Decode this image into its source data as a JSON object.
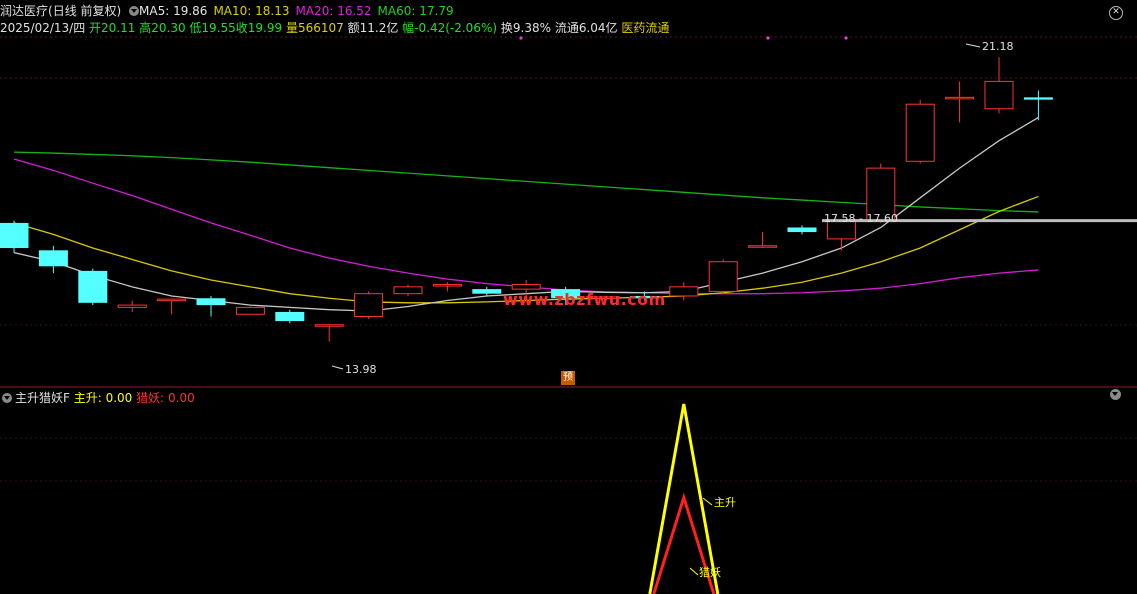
{
  "header": {
    "stock_name": "润达医疗",
    "period_label": "(日线 前复权)",
    "ma5_label": "MA5: 19.86",
    "ma10_label": "MA10: 18.13",
    "ma20_label": "MA20: 16.52",
    "ma60_label": "MA60: 17.79",
    "date": "2025/02/13/四",
    "open": "开20.11",
    "high": "高20.30",
    "low": "低19.55",
    "close": "收19.99",
    "volume": "量566107",
    "amount": "额11.2亿",
    "change": "幅-0.42(-2.06%)",
    "turnover": "换9.38%",
    "float_value": "流通6.04亿",
    "sector": "医药流通"
  },
  "indicator": {
    "name": "主升猎妖F",
    "main_label": "主升: 0.00",
    "hunt_label": "猎妖: 0.00",
    "arrow_main": "主升",
    "arrow_hunt": "猎妖"
  },
  "annotations": {
    "high_price": "21.18",
    "low_price": "13.98",
    "range_label": "17.58 - 17.60",
    "watermark": "www.zbzfwu.com",
    "badge": "预"
  },
  "colors": {
    "up": "#ff3333",
    "down": "#54ffff",
    "ma5": "#c8c8c8",
    "ma10": "#d8c800",
    "ma20": "#d21ed2",
    "ma60": "#14b414",
    "zhusheng": "#ffff00",
    "lieyao": "#ff2020"
  },
  "chart_data": {
    "type": "candlestick",
    "candles": [
      {
        "o": 17.55,
        "h": 17.6,
        "l": 16.9,
        "c": 17.0
      },
      {
        "o": 16.95,
        "h": 17.05,
        "l": 16.45,
        "c": 16.6
      },
      {
        "o": 16.5,
        "h": 16.55,
        "l": 15.75,
        "c": 15.8
      },
      {
        "o": 15.7,
        "h": 15.85,
        "l": 15.6,
        "c": 15.75
      },
      {
        "o": 15.85,
        "h": 15.88,
        "l": 15.55,
        "c": 15.88
      },
      {
        "o": 15.9,
        "h": 15.95,
        "l": 15.5,
        "c": 15.75
      },
      {
        "o": 15.55,
        "h": 15.72,
        "l": 15.6,
        "c": 15.7
      },
      {
        "o": 15.6,
        "h": 15.65,
        "l": 15.35,
        "c": 15.4
      },
      {
        "o": 15.3,
        "h": 15.32,
        "l": 14.95,
        "c": 15.32
      },
      {
        "o": 15.5,
        "h": 16.05,
        "l": 15.45,
        "c": 16.0
      },
      {
        "o": 16.0,
        "h": 16.2,
        "l": 15.95,
        "c": 16.15
      },
      {
        "o": 16.2,
        "h": 16.25,
        "l": 16.05,
        "c": 16.2
      },
      {
        "o": 16.1,
        "h": 16.15,
        "l": 15.95,
        "c": 16.0
      },
      {
        "o": 16.1,
        "h": 16.3,
        "l": 15.95,
        "c": 16.2
      },
      {
        "o": 16.1,
        "h": 16.15,
        "l": 15.75,
        "c": 15.9
      },
      {
        "o": 15.9,
        "h": 15.95,
        "l": 15.85,
        "c": 15.93
      },
      {
        "o": 15.95,
        "h": 16.05,
        "l": 15.85,
        "c": 15.9
      },
      {
        "o": 15.95,
        "h": 16.25,
        "l": 15.85,
        "c": 16.15
      },
      {
        "o": 16.05,
        "h": 16.75,
        "l": 16.0,
        "c": 16.7
      },
      {
        "o": 17.05,
        "h": 17.35,
        "l": 17.0,
        "c": 17.05
      },
      {
        "o": 17.45,
        "h": 17.5,
        "l": 17.3,
        "c": 17.35
      },
      {
        "o": 17.2,
        "h": 17.58,
        "l": 16.95,
        "c": 17.58
      },
      {
        "o": 17.58,
        "h": 18.85,
        "l": 17.55,
        "c": 18.75
      },
      {
        "o": 18.9,
        "h": 20.25,
        "l": 18.85,
        "c": 20.15
      },
      {
        "o": 20.3,
        "h": 20.65,
        "l": 19.75,
        "c": 20.3
      },
      {
        "o": 20.05,
        "h": 21.18,
        "l": 19.95,
        "c": 20.65
      },
      {
        "o": 20.3,
        "h": 20.45,
        "l": 19.8,
        "c": 20.25
      }
    ],
    "ma5": [
      16.9,
      16.7,
      16.4,
      16.15,
      15.95,
      15.85,
      15.75,
      15.7,
      15.65,
      15.62,
      15.72,
      15.85,
      15.95,
      16.0,
      16.05,
      16.03,
      16.02,
      16.05,
      16.25,
      16.45,
      16.7,
      17.0,
      17.45,
      18.1,
      18.75,
      19.35,
      19.86
    ],
    "ma10": [
      17.55,
      17.3,
      17.0,
      16.75,
      16.5,
      16.3,
      16.15,
      16.0,
      15.9,
      15.82,
      15.8,
      15.8,
      15.82,
      15.85,
      15.88,
      15.9,
      15.92,
      15.95,
      16.02,
      16.12,
      16.25,
      16.45,
      16.7,
      17.0,
      17.4,
      17.8,
      18.13
    ],
    "ma20": [
      18.95,
      18.7,
      18.42,
      18.15,
      17.85,
      17.55,
      17.28,
      17.0,
      16.78,
      16.6,
      16.45,
      16.32,
      16.22,
      16.15,
      16.08,
      16.04,
      16.02,
      16.0,
      16.0,
      16.0,
      16.02,
      16.06,
      16.12,
      16.22,
      16.35,
      16.45,
      16.52
    ],
    "ma60": [
      19.1,
      19.08,
      19.05,
      19.02,
      18.98,
      18.93,
      18.88,
      18.82,
      18.76,
      18.7,
      18.64,
      18.58,
      18.52,
      18.46,
      18.4,
      18.34,
      18.28,
      18.22,
      18.16,
      18.1,
      18.05,
      18.0,
      17.95,
      17.9,
      17.86,
      17.82,
      17.79
    ],
    "yrange": [
      14.0,
      21.6
    ],
    "range_line": 17.6,
    "zhusheng": [
      0,
      0,
      0,
      0,
      0,
      0,
      0,
      0,
      0,
      0,
      0,
      0,
      0,
      0,
      0,
      0,
      0,
      1,
      0,
      0,
      0,
      0,
      0,
      0,
      0,
      0,
      0
    ],
    "lieyao": [
      0,
      0,
      0,
      0,
      0,
      0,
      0,
      0,
      0,
      0,
      0,
      0,
      0,
      0,
      0,
      0,
      0,
      0.55,
      0,
      0,
      0,
      0,
      0,
      0,
      0,
      0,
      0
    ]
  }
}
